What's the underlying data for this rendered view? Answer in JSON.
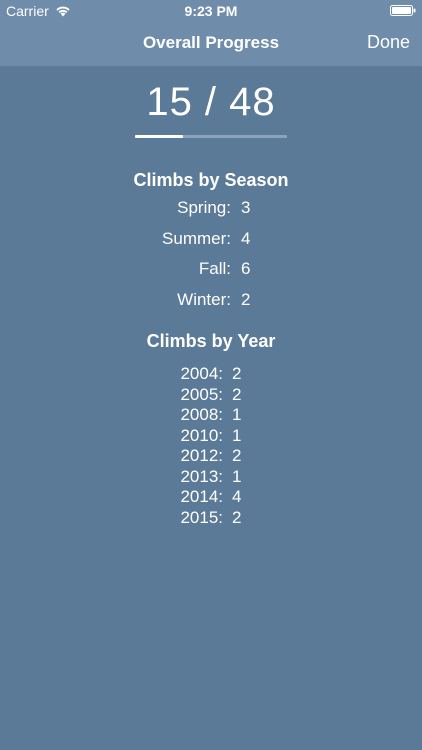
{
  "status_bar": {
    "carrier": "Carrier",
    "time": "9:23 PM",
    "wifi_icon": "wifi-icon",
    "battery_icon": "battery-icon"
  },
  "nav": {
    "title": "Overall Progress",
    "done_label": "Done"
  },
  "progress": {
    "text": "15 / 48",
    "completed": 15,
    "total": 48,
    "fraction": 0.3125
  },
  "seasons": {
    "title": "Climbs by Season",
    "items": [
      {
        "label": "Spring:",
        "value": "3"
      },
      {
        "label": "Summer:",
        "value": "4"
      },
      {
        "label": "Fall:",
        "value": "6"
      },
      {
        "label": "Winter:",
        "value": "2"
      }
    ]
  },
  "years": {
    "title": "Climbs by Year",
    "items": [
      {
        "label": "2004:",
        "value": "2"
      },
      {
        "label": "2005:",
        "value": "2"
      },
      {
        "label": "2008:",
        "value": "1"
      },
      {
        "label": "2010:",
        "value": "1"
      },
      {
        "label": "2012:",
        "value": "2"
      },
      {
        "label": "2013:",
        "value": "1"
      },
      {
        "label": "2014:",
        "value": "4"
      },
      {
        "label": "2015:",
        "value": "2"
      }
    ]
  },
  "colors": {
    "background": "#5b7a98",
    "bar": "#6f8dab",
    "progress_track": "#8aa4bf",
    "progress_fill": "#ffffff",
    "text": "#ffffff"
  }
}
